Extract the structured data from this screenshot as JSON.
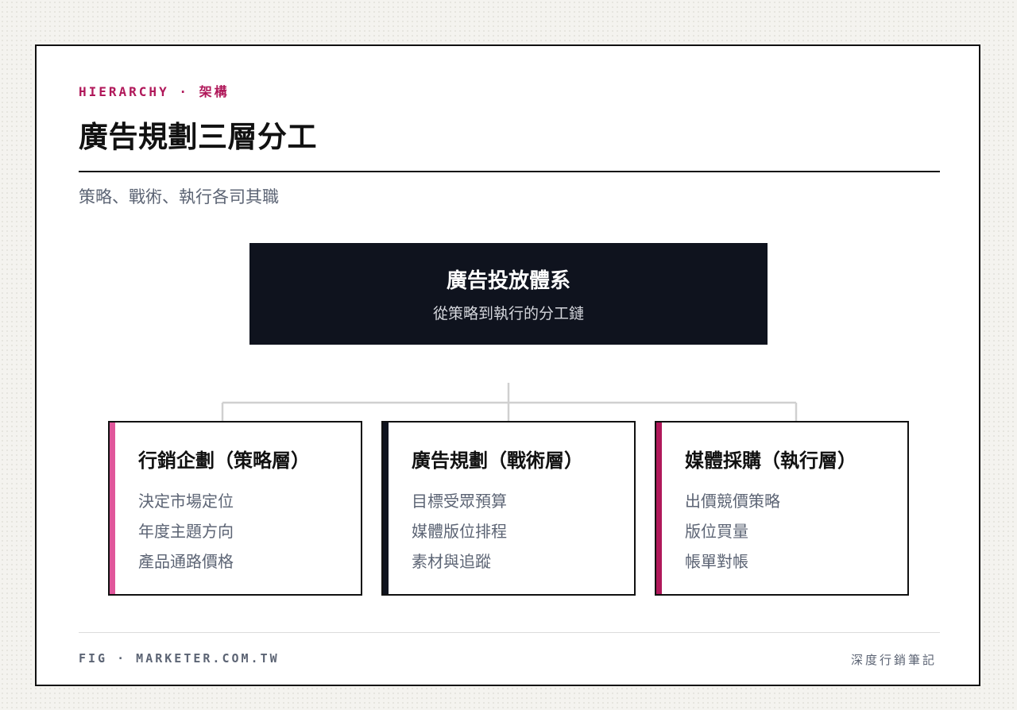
{
  "header": {
    "kicker": "HIERARCHY · 架構",
    "title": "廣告規劃三層分工",
    "subtitle": "策略、戰術、執行各司其職"
  },
  "root": {
    "title": "廣告投放體系",
    "subtitle": "從策略到執行的分工鏈"
  },
  "children": [
    {
      "title": "行銷企劃（策略層）",
      "accent": "#e0569b",
      "items": [
        "決定市場定位",
        "年度主題方向",
        "產品通路價格"
      ]
    },
    {
      "title": "廣告規劃（戰術層）",
      "accent": "#0f131e",
      "items": [
        "目標受眾預算",
        "媒體版位排程",
        "素材與追蹤"
      ]
    },
    {
      "title": "媒體採購（執行層）",
      "accent": "#b0185a",
      "items": [
        "出價競價策略",
        "版位買量",
        "帳單對帳"
      ]
    }
  ],
  "footer": {
    "left": "FIG · MARKETER.COM.TW",
    "right": "深度行銷筆記"
  },
  "colors": {
    "magenta": "#b0185a",
    "pink": "#e0569b",
    "navy": "#0f131e",
    "muted_text": "#5c6474",
    "connector": "#d0d0d0"
  }
}
